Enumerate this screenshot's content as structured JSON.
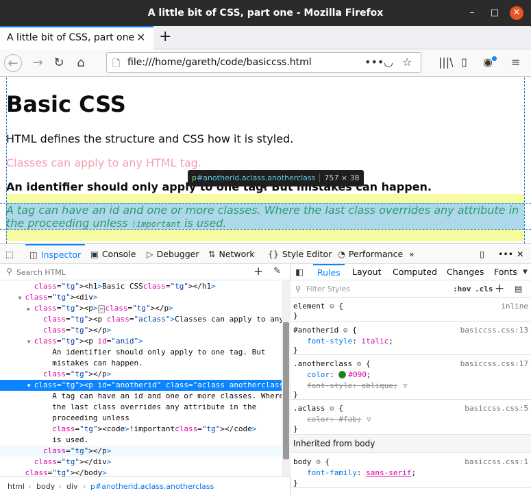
{
  "window": {
    "title": "A little bit of CSS, part one - Mozilla Firefox",
    "min_glyph": "–",
    "max_glyph": "□",
    "close_glyph": "✕"
  },
  "tab": {
    "label": "A little bit of CSS, part one",
    "close_glyph": "✕",
    "newtab_glyph": "+"
  },
  "nav": {
    "back_glyph": "←",
    "forward_glyph": "→",
    "reload_glyph": "↻",
    "home_glyph": "⌂",
    "url": "file:///home/gareth/code/basiccss.html",
    "page_actions_glyph": "•••",
    "pocket_glyph": "◡",
    "star_glyph": "☆",
    "library_glyph": "|||\\",
    "sidebar_glyph": "▯",
    "account_glyph": "◉",
    "menu_glyph": "≡",
    "file_icon_glyph": "🗋"
  },
  "page": {
    "heading": "Basic CSS",
    "p1": "HTML defines the structure and CSS how it is styled.",
    "p2": "Classes can apply to any HTML tag.",
    "p3": "An identifier should only apply to one tag. But mistakes can happen.",
    "p4_a": "A tag can have an id and one or more classes. Where the last class overrides any attribute in the proceeding unless ",
    "p4_code": "!important",
    "p4_b": " is used."
  },
  "infobar": {
    "tag": "p",
    "id": "#anotherid",
    "classes": ".aclass.anotherclass",
    "dimensions": "757 × 38"
  },
  "devtools": {
    "tabs": {
      "inspector": "Inspector",
      "console": "Console",
      "debugger": "Debugger",
      "network": "Network",
      "style_editor": "Style Editor",
      "performance": "Performance"
    },
    "search_placeholder": "Search HTML",
    "tree": [
      {
        "pre": "      ",
        "tw": "",
        "text": "<h1>Basic CSS</h1>"
      },
      {
        "pre": "    ",
        "tw": "▼",
        "text": "<div>"
      },
      {
        "pre": "      ",
        "tw": "▶",
        "text": "<p>⋯</p>"
      },
      {
        "pre": "        ",
        "tw": "",
        "text": "<p class=\"aclass\">Classes can apply to any HTML tag."
      },
      {
        "pre": "        ",
        "tw": "",
        "text": "</p>"
      },
      {
        "pre": "      ",
        "tw": "▼",
        "text": "<p id=\"anid\">"
      },
      {
        "pre": "          ",
        "tw": "",
        "text": "An identifier should only apply to one tag. But"
      },
      {
        "pre": "          ",
        "tw": "",
        "text": "mistakes can happen."
      },
      {
        "pre": "        ",
        "tw": "",
        "text": "</p>"
      },
      {
        "pre": "      ",
        "tw": "▼",
        "text": "<p id=\"anotherid\" class=\"aclass anotherclass\">"
      },
      {
        "pre": "          ",
        "tw": "",
        "text": "A tag can have an id and one or more classes. Where"
      },
      {
        "pre": "          ",
        "tw": "",
        "text": "the last class overrides any attribute in the"
      },
      {
        "pre": "          ",
        "tw": "",
        "text": "proceeding unless"
      },
      {
        "pre": "          ",
        "tw": "",
        "text": "<code>!important</code>"
      },
      {
        "pre": "          ",
        "tw": "",
        "text": "is used."
      },
      {
        "pre": "        ",
        "tw": "",
        "text": "</p>"
      },
      {
        "pre": "      ",
        "tw": "",
        "text": "</div>"
      },
      {
        "pre": "    ",
        "tw": "",
        "text": "</body>"
      }
    ],
    "breadcrumbs": [
      "html",
      "body",
      "div",
      "p#anotherid.aclass.anotherclass"
    ],
    "rules_tabs": {
      "rules": "Rules",
      "layout": "Layout",
      "computed": "Computed",
      "changes": "Changes",
      "fonts": "Fonts"
    },
    "filter_placeholder": "Filter Styles",
    "hov": ":hov",
    "cls": ".cls",
    "rules": [
      {
        "selector": "element",
        "source": "inline",
        "decls": []
      },
      {
        "selector": "#anotherid",
        "source": "basiccss.css:13",
        "decls": [
          {
            "name": "font-style",
            "value": "italic",
            "overridden": false
          }
        ]
      },
      {
        "selector": ".anotherclass",
        "source": "basiccss.css:17",
        "decls": [
          {
            "name": "color",
            "value": "#090",
            "overridden": false,
            "swatch": "#009900"
          },
          {
            "name": "font-style",
            "value": "oblique",
            "overridden": true
          }
        ]
      },
      {
        "selector": ".aclass",
        "source": "basiccss.css:5",
        "decls": [
          {
            "name": "color",
            "value": "#fab",
            "overridden": true
          }
        ]
      }
    ],
    "inherited_header": "Inherited from body",
    "body_rule": {
      "selector": "body",
      "source": "basiccss.css:1",
      "decl_name": "font-family",
      "decl_value": "sans-serif"
    }
  }
}
